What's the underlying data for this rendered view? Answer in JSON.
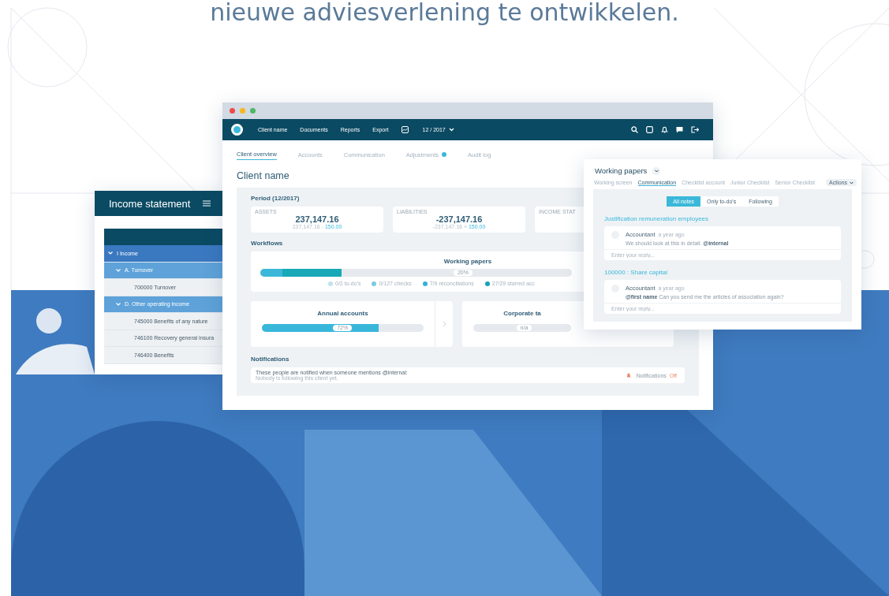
{
  "heading": "nieuwe adviesverlening te ontwikkelen.",
  "income_window": {
    "title": "Income statement",
    "rows": [
      {
        "label": "I Income",
        "expanded": true,
        "children": [
          {
            "label": "A. Turnover",
            "expanded": true,
            "children": [
              {
                "label": "700000 Turnover"
              }
            ]
          },
          {
            "label": "D. Other operating income",
            "expanded": true,
            "children": [
              {
                "label": "745000 Benefits of any nature"
              },
              {
                "label": "746100 Recovery general insura"
              },
              {
                "label": "746400 Benefits"
              }
            ]
          }
        ]
      }
    ]
  },
  "main_window": {
    "nav": {
      "items": [
        "Client name",
        "Documents",
        "Reports",
        "Export"
      ],
      "period": "12 / 2017"
    },
    "tabs": [
      {
        "label": "Client overview",
        "selected": true,
        "dot": false
      },
      {
        "label": "Accounts",
        "selected": false,
        "dot": false
      },
      {
        "label": "Communication",
        "selected": false,
        "dot": false
      },
      {
        "label": "Adjustments",
        "selected": false,
        "dot": true
      },
      {
        "label": "Audit log",
        "selected": false,
        "dot": false
      }
    ],
    "title": "Client name",
    "period_heading": "Period (12/2017)",
    "stats": [
      {
        "label": "ASSETS",
        "value": "237,147.16",
        "base": "237,147.16 -",
        "delta": "150.00"
      },
      {
        "label": "LIABILITIES",
        "value": "-237,147.16",
        "base": "-237,147.16 +",
        "delta": "150.00"
      },
      {
        "label": "INCOME STAT"
      }
    ],
    "workflows_heading": "Workflows",
    "working_papers": {
      "title": "Working papers",
      "label": "20%",
      "segments": [
        {
          "level": 0.07,
          "color": "#3bb8d9"
        },
        {
          "level": 0.19,
          "color": "#17a9b8"
        }
      ],
      "legend": [
        {
          "text": "0/2 to-do's",
          "color": "#bfe3ef"
        },
        {
          "text": "0/127 checks",
          "color": "#7ccbe0"
        },
        {
          "text": "7/9 reconciliations",
          "color": "#33b3d6"
        },
        {
          "text": "27/29 starred acc",
          "color": "#17a2b5"
        }
      ]
    },
    "workflow_cards": [
      {
        "title": "Annual accounts",
        "level": 0.72,
        "label": "72%"
      },
      {
        "title": "Corporate ta",
        "level": 0,
        "label": "n/a"
      }
    ],
    "notifications_heading": "Notifications",
    "notification": {
      "text": "These people are notified when someone mentions @internal:",
      "subtext": "Nobody is following this client yet.",
      "label": "Notifications",
      "state": "Off"
    }
  },
  "wp_window": {
    "title": "Working papers",
    "tabs": [
      {
        "label": "Working screen",
        "selected": false
      },
      {
        "label": "Communication",
        "selected": true
      },
      {
        "label": "Checklist account",
        "selected": false
      },
      {
        "label": "Junior Checklist",
        "selected": false
      },
      {
        "label": "Senior Checklist",
        "selected": false
      }
    ],
    "actions": "Actions",
    "filters": [
      {
        "label": "All notes",
        "selected": true
      },
      {
        "label": "Only to-do's",
        "selected": false
      },
      {
        "label": "Following",
        "selected": false
      }
    ],
    "threads": [
      {
        "heading": "Justification remuneration employees",
        "author": "Accountant",
        "time": "a year ago",
        "text": "We should look at this in detail. **@internal**",
        "placeholder": "Enter your reply..."
      },
      {
        "heading": "100000 : Share capital",
        "author": "Accountant",
        "time": "a year ago",
        "text": "**@first name** Can you send me the articles of association again?",
        "placeholder": "Enter your reply..."
      }
    ]
  }
}
